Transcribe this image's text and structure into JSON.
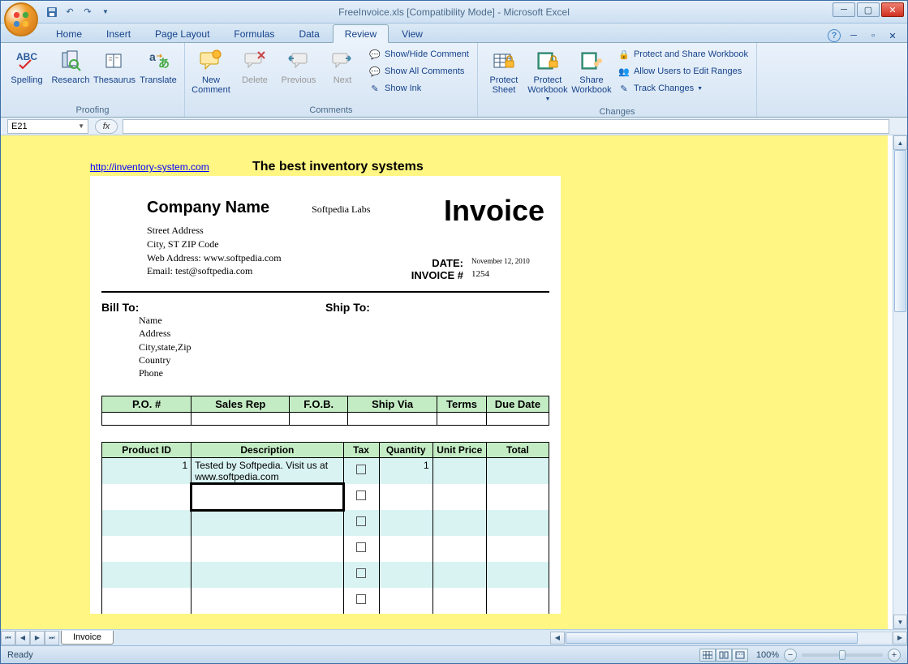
{
  "title": "FreeInvoice.xls  [Compatibility Mode] - Microsoft Excel",
  "tabs": {
    "home": "Home",
    "insert": "Insert",
    "pagelayout": "Page Layout",
    "formulas": "Formulas",
    "data": "Data",
    "review": "Review",
    "view": "View"
  },
  "ribbon": {
    "proofing": {
      "label": "Proofing",
      "spelling": "Spelling",
      "research": "Research",
      "thesaurus": "Thesaurus",
      "translate": "Translate"
    },
    "comments": {
      "label": "Comments",
      "new": "New Comment",
      "delete": "Delete",
      "previous": "Previous",
      "next": "Next",
      "showhide": "Show/Hide Comment",
      "showall": "Show All Comments",
      "showink": "Show Ink"
    },
    "changes": {
      "label": "Changes",
      "protectsheet": "Protect Sheet",
      "protectwb": "Protect Workbook",
      "sharewb": "Share Workbook",
      "protectshare": "Protect and Share Workbook",
      "allowusers": "Allow Users to Edit Ranges",
      "trackchanges": "Track Changes"
    }
  },
  "namebox": "E21",
  "sheet": {
    "link": "http://inventory-system.com",
    "tagline": "The best inventory systems",
    "company_label": "Company Name",
    "company_value": "Softpedia Labs",
    "invoice_title": "Invoice",
    "address": {
      "street": "Street Address",
      "city": "City, ST  ZIP Code",
      "web": "Web Address: www.softpedia.com",
      "email": "Email: test@softpedia.com"
    },
    "meta": {
      "date_label": "DATE:",
      "date_value": "November 12, 2010",
      "inv_label": "INVOICE #",
      "inv_value": "1254"
    },
    "billto": "Bill To:",
    "shipto": "Ship To:",
    "bill_lines": {
      "name": "Name",
      "address": "Address",
      "csz": "City,state,Zip",
      "country": "Country",
      "phone": "Phone"
    },
    "headers1": {
      "po": "P.O. #",
      "rep": "Sales Rep",
      "fob": "F.O.B.",
      "ship": "Ship Via",
      "terms": "Terms",
      "due": "Due Date"
    },
    "headers2": {
      "pid": "Product ID",
      "desc": "Description",
      "tax": "Tax",
      "qty": "Quantity",
      "price": "Unit Price",
      "total": "Total"
    },
    "row1": {
      "pid": "1",
      "desc": "Tested by Softpedia. Visit us at www.softpedia.com",
      "qty": "1"
    }
  },
  "sheet_tab": "Invoice",
  "status": {
    "ready": "Ready",
    "zoom": "100%"
  }
}
